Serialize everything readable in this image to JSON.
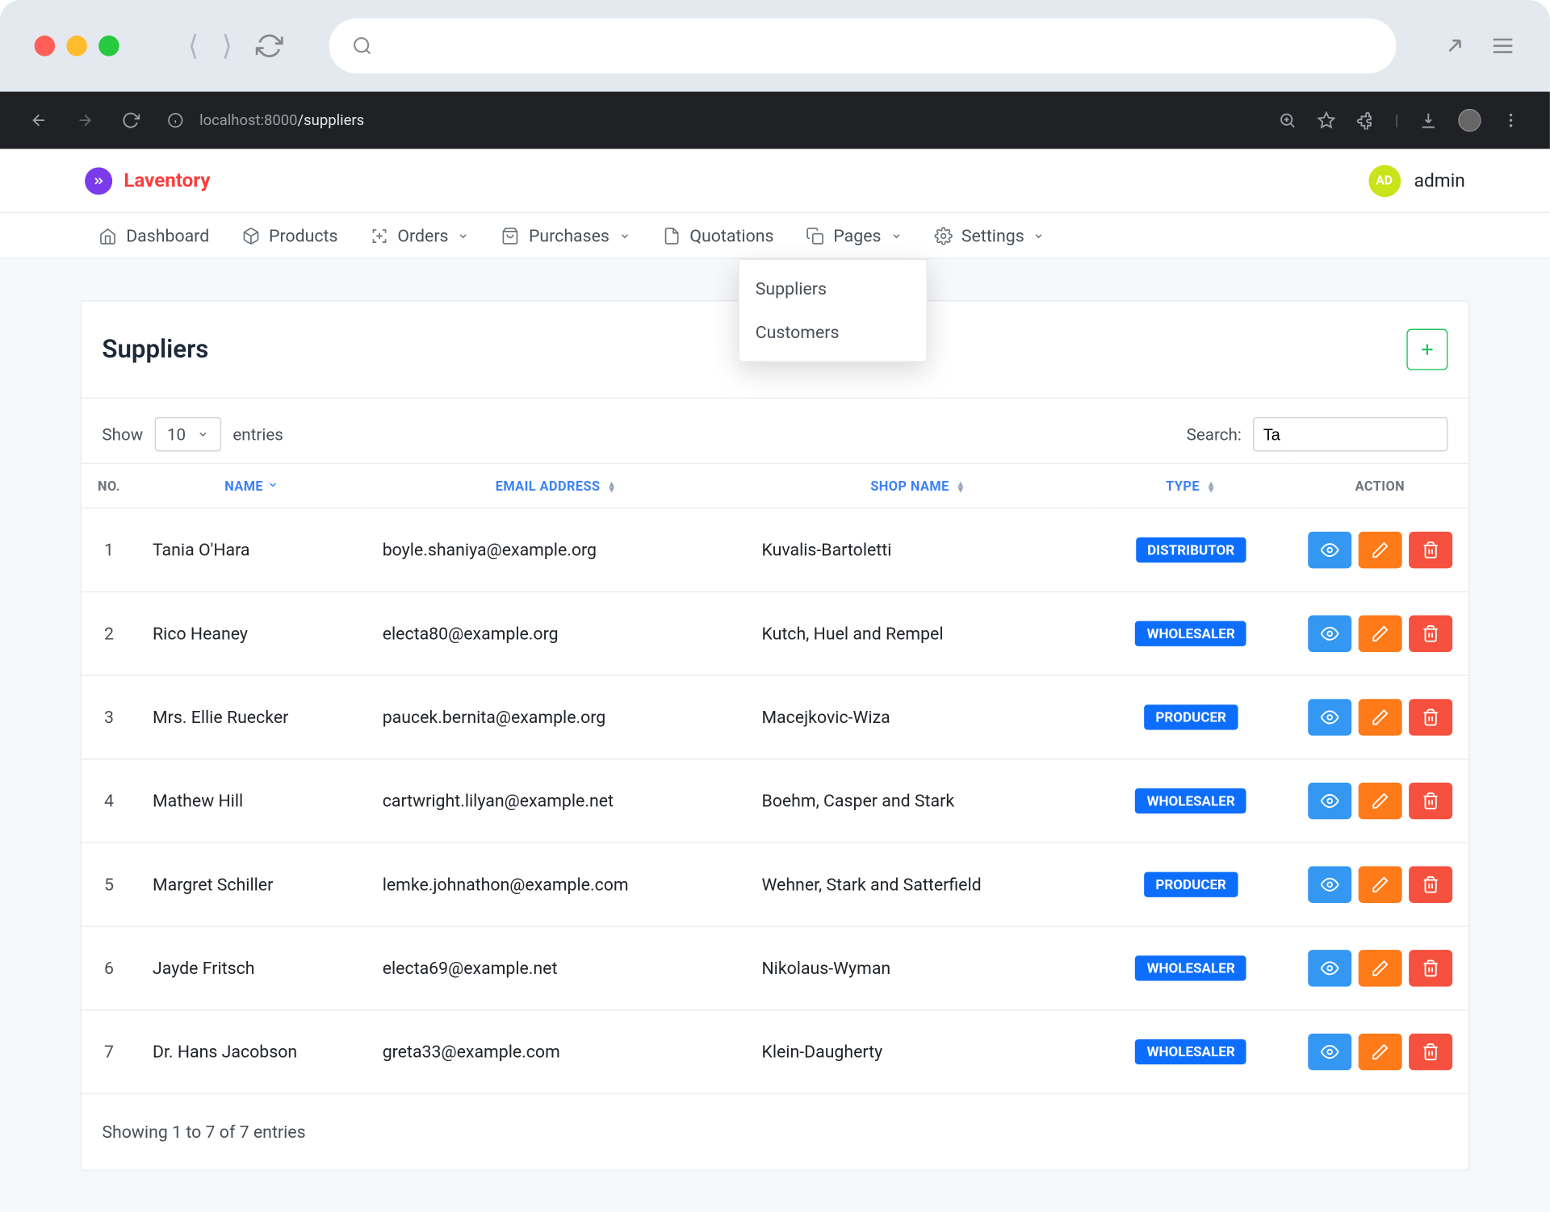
{
  "browser": {
    "url_host": "localhost:8000",
    "url_path": "/suppliers"
  },
  "app": {
    "brand": "Laventory",
    "user_initials": "AD",
    "user_label": "admin"
  },
  "nav": {
    "dashboard": "Dashboard",
    "products": "Products",
    "orders": "Orders",
    "purchases": "Purchases",
    "quotations": "Quotations",
    "pages": "Pages",
    "settings": "Settings",
    "dropdown": {
      "suppliers": "Suppliers",
      "customers": "Customers"
    }
  },
  "page": {
    "title": "Suppliers",
    "show_label_pre": "Show",
    "show_value": "10",
    "show_label_post": "entries",
    "search_label": "Search:",
    "search_value": "Ta",
    "columns": {
      "no": "NO.",
      "name": "NAME",
      "email": "EMAIL ADDRESS",
      "shop": "SHOP NAME",
      "type": "TYPE",
      "action": "ACTION"
    },
    "rows": [
      {
        "no": "1",
        "name": "Tania O'Hara",
        "email": "boyle.shaniya@example.org",
        "shop": "Kuvalis-Bartoletti",
        "type": "DISTRIBUTOR"
      },
      {
        "no": "2",
        "name": "Rico Heaney",
        "email": "electa80@example.org",
        "shop": "Kutch, Huel and Rempel",
        "type": "WHOLESALER"
      },
      {
        "no": "3",
        "name": "Mrs. Ellie Ruecker",
        "email": "paucek.bernita@example.org",
        "shop": "Macejkovic-Wiza",
        "type": "PRODUCER"
      },
      {
        "no": "4",
        "name": "Mathew Hill",
        "email": "cartwright.lilyan@example.net",
        "shop": "Boehm, Casper and Stark",
        "type": "WHOLESALER"
      },
      {
        "no": "5",
        "name": "Margret Schiller",
        "email": "lemke.johnathon@example.com",
        "shop": "Wehner, Stark and Satterfield",
        "type": "PRODUCER"
      },
      {
        "no": "6",
        "name": "Jayde Fritsch",
        "email": "electa69@example.net",
        "shop": "Nikolaus-Wyman",
        "type": "WHOLESALER"
      },
      {
        "no": "7",
        "name": "Dr. Hans Jacobson",
        "email": "greta33@example.com",
        "shop": "Klein-Daugherty",
        "type": "WHOLESALER"
      }
    ],
    "footer_text": "Showing 1 to 7 of 7 entries"
  }
}
